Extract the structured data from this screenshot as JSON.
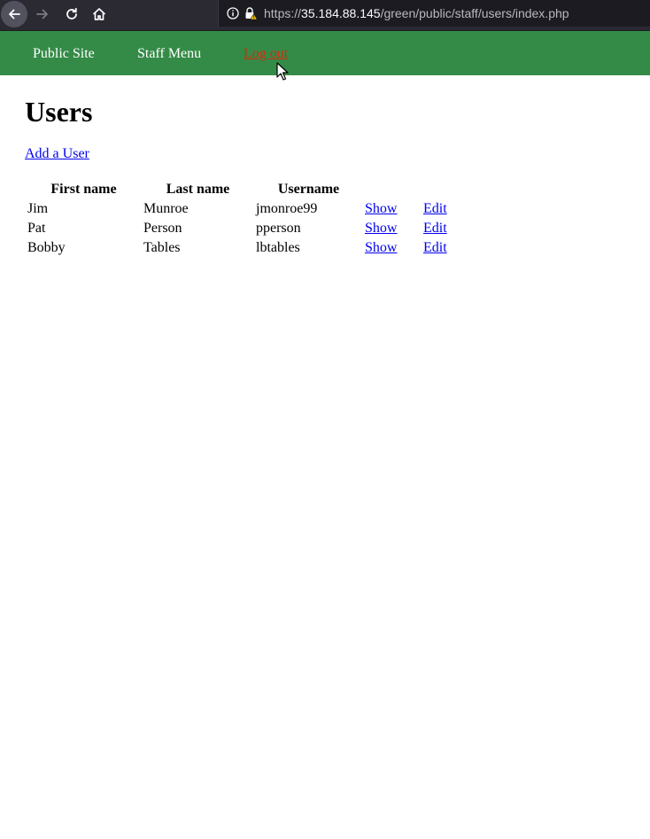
{
  "browser": {
    "url_prefix": "https://",
    "url_host": "35.184.88.145",
    "url_path": "/green/public/staff/users/index.php",
    "icons": [
      "back-arrow-icon",
      "forward-arrow-icon",
      "reload-icon",
      "home-icon",
      "info-icon",
      "insecure-lock-icon"
    ]
  },
  "site_nav": {
    "public_site": "Public Site",
    "staff_menu": "Staff Menu",
    "log_out": "Log out"
  },
  "page": {
    "title": "Users",
    "add_user_link": "Add a User"
  },
  "users_table": {
    "headers": [
      "First name",
      "Last name",
      "Username",
      "",
      ""
    ],
    "rows": [
      {
        "first_name": "Jim",
        "last_name": "Munroe",
        "username": "jmonroe99",
        "show": "Show",
        "edit": "Edit"
      },
      {
        "first_name": "Pat",
        "last_name": "Person",
        "username": "pperson",
        "show": "Show",
        "edit": "Edit"
      },
      {
        "first_name": "Bobby",
        "last_name": "Tables",
        "username": "lbtables",
        "show": "Show",
        "edit": "Edit"
      }
    ]
  },
  "colors": {
    "header_green": "#348b47",
    "logout_red": "#d52b0e",
    "link_blue": "#0000ee",
    "toolbar_dark": "#2b2a33"
  }
}
